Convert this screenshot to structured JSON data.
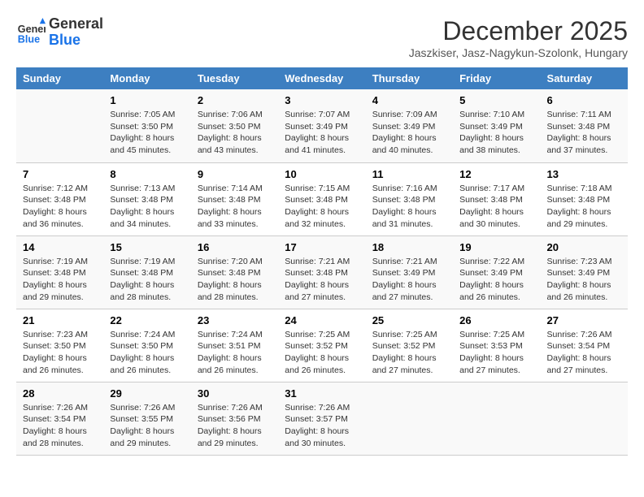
{
  "header": {
    "logo_line1": "General",
    "logo_line2": "Blue",
    "month": "December 2025",
    "location": "Jaszkiser, Jasz-Nagykun-Szolonk, Hungary"
  },
  "columns": [
    "Sunday",
    "Monday",
    "Tuesday",
    "Wednesday",
    "Thursday",
    "Friday",
    "Saturday"
  ],
  "weeks": [
    [
      {
        "day": "",
        "sunrise": "",
        "sunset": "",
        "daylight": ""
      },
      {
        "day": "1",
        "sunrise": "Sunrise: 7:05 AM",
        "sunset": "Sunset: 3:50 PM",
        "daylight": "Daylight: 8 hours and 45 minutes."
      },
      {
        "day": "2",
        "sunrise": "Sunrise: 7:06 AM",
        "sunset": "Sunset: 3:50 PM",
        "daylight": "Daylight: 8 hours and 43 minutes."
      },
      {
        "day": "3",
        "sunrise": "Sunrise: 7:07 AM",
        "sunset": "Sunset: 3:49 PM",
        "daylight": "Daylight: 8 hours and 41 minutes."
      },
      {
        "day": "4",
        "sunrise": "Sunrise: 7:09 AM",
        "sunset": "Sunset: 3:49 PM",
        "daylight": "Daylight: 8 hours and 40 minutes."
      },
      {
        "day": "5",
        "sunrise": "Sunrise: 7:10 AM",
        "sunset": "Sunset: 3:49 PM",
        "daylight": "Daylight: 8 hours and 38 minutes."
      },
      {
        "day": "6",
        "sunrise": "Sunrise: 7:11 AM",
        "sunset": "Sunset: 3:48 PM",
        "daylight": "Daylight: 8 hours and 37 minutes."
      }
    ],
    [
      {
        "day": "7",
        "sunrise": "Sunrise: 7:12 AM",
        "sunset": "Sunset: 3:48 PM",
        "daylight": "Daylight: 8 hours and 36 minutes."
      },
      {
        "day": "8",
        "sunrise": "Sunrise: 7:13 AM",
        "sunset": "Sunset: 3:48 PM",
        "daylight": "Daylight: 8 hours and 34 minutes."
      },
      {
        "day": "9",
        "sunrise": "Sunrise: 7:14 AM",
        "sunset": "Sunset: 3:48 PM",
        "daylight": "Daylight: 8 hours and 33 minutes."
      },
      {
        "day": "10",
        "sunrise": "Sunrise: 7:15 AM",
        "sunset": "Sunset: 3:48 PM",
        "daylight": "Daylight: 8 hours and 32 minutes."
      },
      {
        "day": "11",
        "sunrise": "Sunrise: 7:16 AM",
        "sunset": "Sunset: 3:48 PM",
        "daylight": "Daylight: 8 hours and 31 minutes."
      },
      {
        "day": "12",
        "sunrise": "Sunrise: 7:17 AM",
        "sunset": "Sunset: 3:48 PM",
        "daylight": "Daylight: 8 hours and 30 minutes."
      },
      {
        "day": "13",
        "sunrise": "Sunrise: 7:18 AM",
        "sunset": "Sunset: 3:48 PM",
        "daylight": "Daylight: 8 hours and 29 minutes."
      }
    ],
    [
      {
        "day": "14",
        "sunrise": "Sunrise: 7:19 AM",
        "sunset": "Sunset: 3:48 PM",
        "daylight": "Daylight: 8 hours and 29 minutes."
      },
      {
        "day": "15",
        "sunrise": "Sunrise: 7:19 AM",
        "sunset": "Sunset: 3:48 PM",
        "daylight": "Daylight: 8 hours and 28 minutes."
      },
      {
        "day": "16",
        "sunrise": "Sunrise: 7:20 AM",
        "sunset": "Sunset: 3:48 PM",
        "daylight": "Daylight: 8 hours and 28 minutes."
      },
      {
        "day": "17",
        "sunrise": "Sunrise: 7:21 AM",
        "sunset": "Sunset: 3:48 PM",
        "daylight": "Daylight: 8 hours and 27 minutes."
      },
      {
        "day": "18",
        "sunrise": "Sunrise: 7:21 AM",
        "sunset": "Sunset: 3:49 PM",
        "daylight": "Daylight: 8 hours and 27 minutes."
      },
      {
        "day": "19",
        "sunrise": "Sunrise: 7:22 AM",
        "sunset": "Sunset: 3:49 PM",
        "daylight": "Daylight: 8 hours and 26 minutes."
      },
      {
        "day": "20",
        "sunrise": "Sunrise: 7:23 AM",
        "sunset": "Sunset: 3:49 PM",
        "daylight": "Daylight: 8 hours and 26 minutes."
      }
    ],
    [
      {
        "day": "21",
        "sunrise": "Sunrise: 7:23 AM",
        "sunset": "Sunset: 3:50 PM",
        "daylight": "Daylight: 8 hours and 26 minutes."
      },
      {
        "day": "22",
        "sunrise": "Sunrise: 7:24 AM",
        "sunset": "Sunset: 3:50 PM",
        "daylight": "Daylight: 8 hours and 26 minutes."
      },
      {
        "day": "23",
        "sunrise": "Sunrise: 7:24 AM",
        "sunset": "Sunset: 3:51 PM",
        "daylight": "Daylight: 8 hours and 26 minutes."
      },
      {
        "day": "24",
        "sunrise": "Sunrise: 7:25 AM",
        "sunset": "Sunset: 3:52 PM",
        "daylight": "Daylight: 8 hours and 26 minutes."
      },
      {
        "day": "25",
        "sunrise": "Sunrise: 7:25 AM",
        "sunset": "Sunset: 3:52 PM",
        "daylight": "Daylight: 8 hours and 27 minutes."
      },
      {
        "day": "26",
        "sunrise": "Sunrise: 7:25 AM",
        "sunset": "Sunset: 3:53 PM",
        "daylight": "Daylight: 8 hours and 27 minutes."
      },
      {
        "day": "27",
        "sunrise": "Sunrise: 7:26 AM",
        "sunset": "Sunset: 3:54 PM",
        "daylight": "Daylight: 8 hours and 27 minutes."
      }
    ],
    [
      {
        "day": "28",
        "sunrise": "Sunrise: 7:26 AM",
        "sunset": "Sunset: 3:54 PM",
        "daylight": "Daylight: 8 hours and 28 minutes."
      },
      {
        "day": "29",
        "sunrise": "Sunrise: 7:26 AM",
        "sunset": "Sunset: 3:55 PM",
        "daylight": "Daylight: 8 hours and 29 minutes."
      },
      {
        "day": "30",
        "sunrise": "Sunrise: 7:26 AM",
        "sunset": "Sunset: 3:56 PM",
        "daylight": "Daylight: 8 hours and 29 minutes."
      },
      {
        "day": "31",
        "sunrise": "Sunrise: 7:26 AM",
        "sunset": "Sunset: 3:57 PM",
        "daylight": "Daylight: 8 hours and 30 minutes."
      },
      {
        "day": "",
        "sunrise": "",
        "sunset": "",
        "daylight": ""
      },
      {
        "day": "",
        "sunrise": "",
        "sunset": "",
        "daylight": ""
      },
      {
        "day": "",
        "sunrise": "",
        "sunset": "",
        "daylight": ""
      }
    ]
  ]
}
